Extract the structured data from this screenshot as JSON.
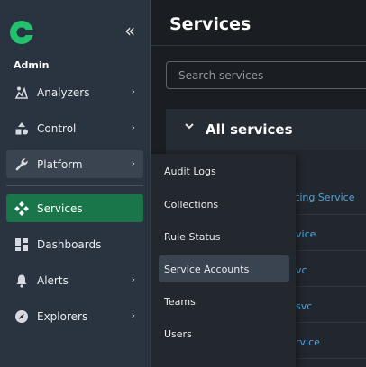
{
  "sidebar": {
    "org_name": "Admin",
    "collapse_icon": "double-chevron-left-icon",
    "items": [
      {
        "label": "Analyzers",
        "icon": "analyzers-icon",
        "has_submenu": true
      },
      {
        "label": "Control",
        "icon": "control-shapes-icon",
        "has_submenu": true
      },
      {
        "label": "Platform",
        "icon": "wrench-icon",
        "has_submenu": true,
        "state": "hover"
      },
      {
        "label": "Services",
        "icon": "services-icon",
        "has_submenu": false,
        "state": "active"
      },
      {
        "label": "Dashboards",
        "icon": "dashboard-icon",
        "has_submenu": false
      },
      {
        "label": "Alerts",
        "icon": "bell-icon",
        "has_submenu": true
      },
      {
        "label": "Explorers",
        "icon": "compass-icon",
        "has_submenu": true
      }
    ],
    "chevron": "›"
  },
  "main": {
    "title": "Services",
    "search": {
      "placeholder": "Search services",
      "value": ""
    },
    "panel": {
      "title": "All services",
      "chevron": "⌄",
      "visible_links": [
        "ting Service",
        "vice",
        "vc",
        "svc",
        "rvice"
      ]
    }
  },
  "flyout": {
    "items": [
      {
        "label": "Audit Logs"
      },
      {
        "label": "Collections"
      },
      {
        "label": "Rule Status"
      },
      {
        "label": "Service Accounts",
        "state": "hover"
      },
      {
        "label": "Teams"
      },
      {
        "label": "Users"
      }
    ]
  },
  "colors": {
    "sidebar_bg": "#2a3340",
    "active_item": "#18764a",
    "link": "#4aa3df",
    "brand_green": "#22c55e"
  }
}
